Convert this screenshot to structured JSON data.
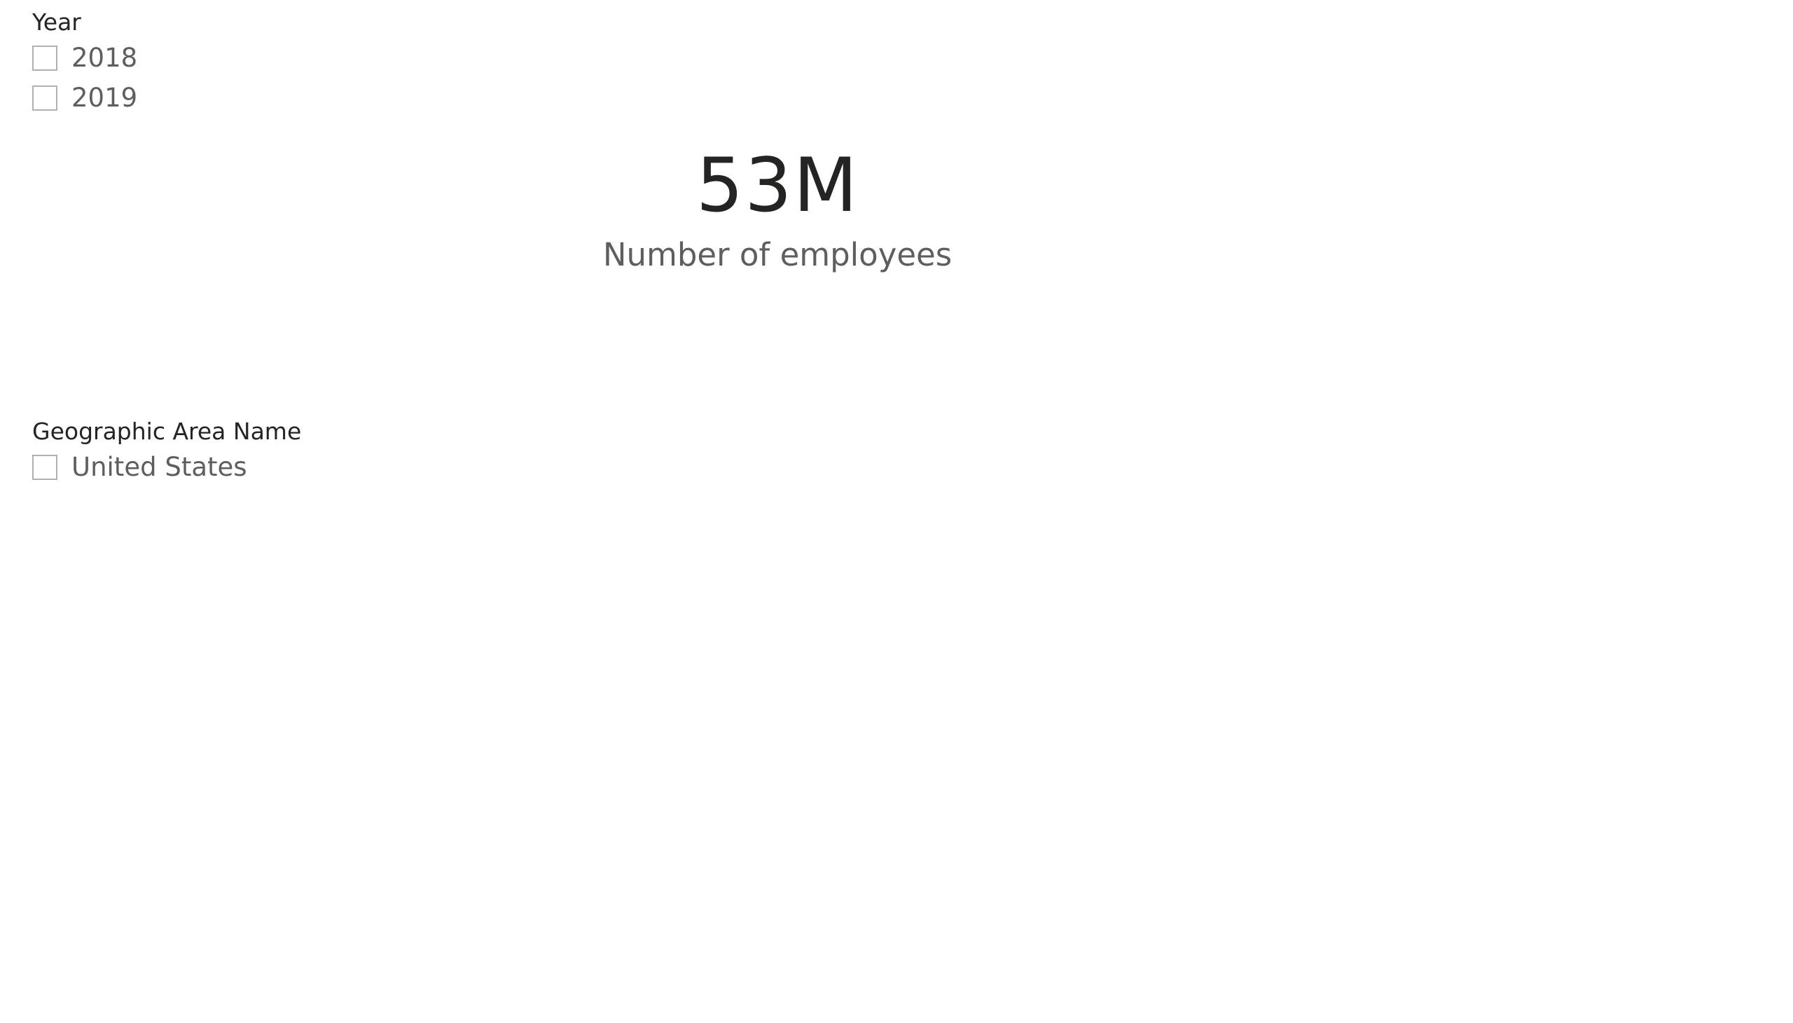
{
  "year_slicer": {
    "title": "Year",
    "items": [
      {
        "label": "2018",
        "checked": false
      },
      {
        "label": "2019",
        "checked": false
      }
    ]
  },
  "card": {
    "value": "53M",
    "label": "Number of employees"
  },
  "geo_slicer": {
    "title": "Geographic Area Name",
    "items": [
      {
        "label": "United States",
        "checked": false
      }
    ]
  },
  "colors": {
    "text_primary": "#252423",
    "text_secondary": "#605e5c",
    "checkbox_border": "#b3b0ad",
    "background": "#ffffff"
  }
}
